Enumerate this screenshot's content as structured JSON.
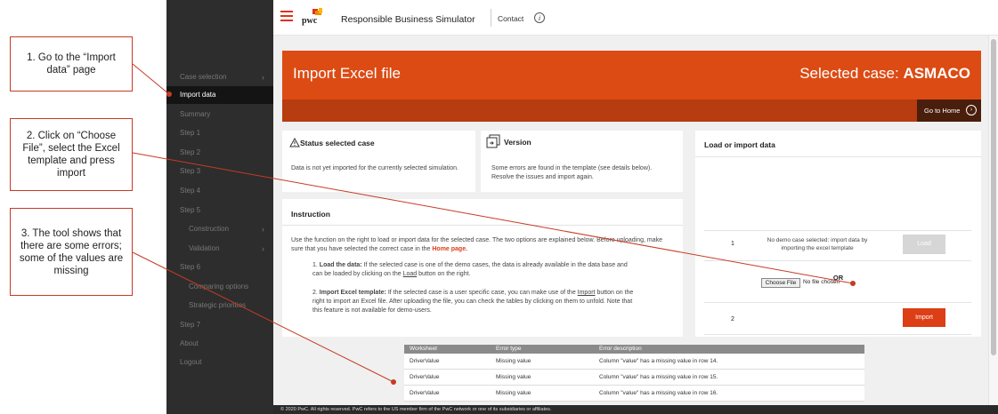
{
  "callouts": [
    "1. Go to the “Import data” page",
    "2. Click on “Choose File”, select the Excel template and press import",
    "3. The tool shows that there are some errors; some of the values are missing"
  ],
  "header": {
    "logo_text": "pwc",
    "app_title": "Responsible Business Simulator",
    "contact": "Contact"
  },
  "sidebar": {
    "items": [
      {
        "label": "Case selection"
      },
      {
        "label": "Import data"
      },
      {
        "label": "Summary"
      },
      {
        "label": "Step 1"
      },
      {
        "label": "Step 2"
      },
      {
        "label": "Step 3"
      },
      {
        "label": "Step 4"
      },
      {
        "label": "Step 5"
      },
      {
        "label": "Construction"
      },
      {
        "label": "Validation"
      },
      {
        "label": "Step 6"
      },
      {
        "label": "Comparing options"
      },
      {
        "label": "Strategic priorities"
      },
      {
        "label": "Step 7"
      },
      {
        "label": "About"
      },
      {
        "label": "Logout"
      }
    ]
  },
  "banner": {
    "title": "Import Excel file",
    "case_label": "Selected case:",
    "case_name": "ASMACO",
    "go_home": "Go to Home"
  },
  "status_card": {
    "title": "Status selected case",
    "text": "Data is not yet imported for the currently selected simulation."
  },
  "version_card": {
    "title": "Version",
    "text": "Some errors are found in the template (see details below). Resolve the issues and import again."
  },
  "instruction": {
    "title": "Instruction",
    "intro_a": "Use the function on the right to load or import data for the selected case. The two options are explained below. Before uploading, make sure that you have selected the correct case in the ",
    "intro_link": "Home page.",
    "item1_bold": "Load the data:",
    "item1_a": " If the selected case is one of the demo cases, the data is already available in the data base and can be loaded by clicking on the ",
    "item1_link": "Load",
    "item1_b": " button on the right.",
    "item2_bold": "Import Excel template:",
    "item2_a": " If the selected case is a user specific case, you can make use of the ",
    "item2_link": "Import",
    "item2_b": " button on the right to import an Excel file. After uploading the file, you can check the tables by clicking on them to unfold. Note that this feature is not available for demo-users."
  },
  "load_card": {
    "title": "Load or import data",
    "row1_num": "1",
    "row1_text": "No demo case selected: import data by importing the excel template",
    "load_button": "Load",
    "or": "OR",
    "row2_num": "2",
    "choose_file": "Choose File",
    "no_file": "No file chosen",
    "import_button": "Import"
  },
  "errors": {
    "headers": [
      "Worksheet",
      "Error type",
      "Error description"
    ],
    "rows": [
      [
        "DriverValue",
        "Missing value",
        "Column \"value\" has a missing value in row 14."
      ],
      [
        "DriverValue",
        "Missing value",
        "Column \"value\" has a missing value in row 15."
      ],
      [
        "DriverValue",
        "Missing value",
        "Column \"value\" has a missing value in row 16."
      ]
    ]
  },
  "footer": "© 2020 PwC. All rights reserved. PwC refers to the US member firm of the PwC network or one of its subsidiaries or affiliates.",
  "colors": {
    "accent": "#dc4b14",
    "sidebar": "#2d2d2d",
    "annotation": "#c53b25"
  }
}
